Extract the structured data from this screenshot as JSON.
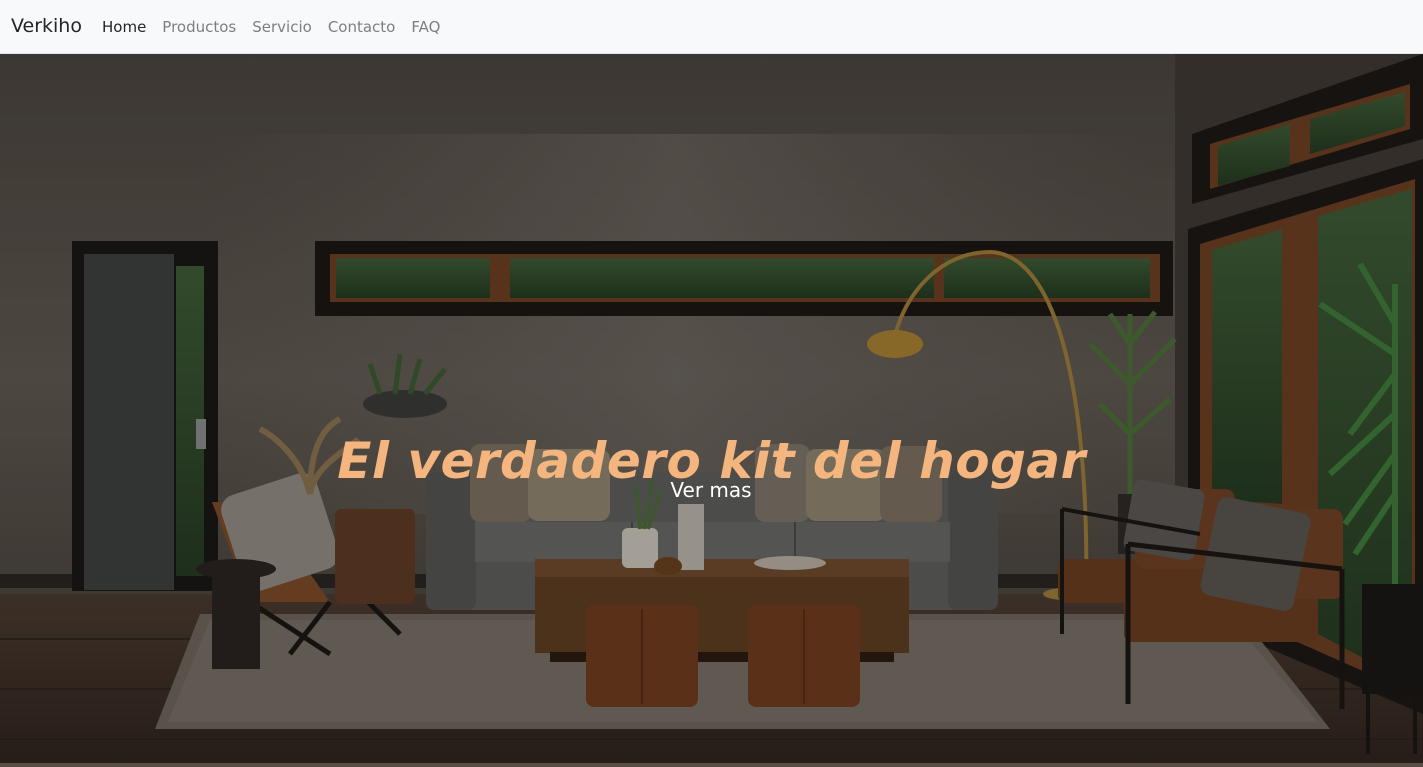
{
  "navbar": {
    "brand": "Verkiho",
    "links": [
      {
        "label": "Home",
        "active": true
      },
      {
        "label": "Productos",
        "active": false
      },
      {
        "label": "Servicio",
        "active": false
      },
      {
        "label": "Contacto",
        "active": false
      },
      {
        "label": "FAQ",
        "active": false
      }
    ]
  },
  "hero": {
    "title": "El verdadero kit del hogar",
    "button_label": "Ver mas",
    "title_color": "#f4b57f"
  }
}
